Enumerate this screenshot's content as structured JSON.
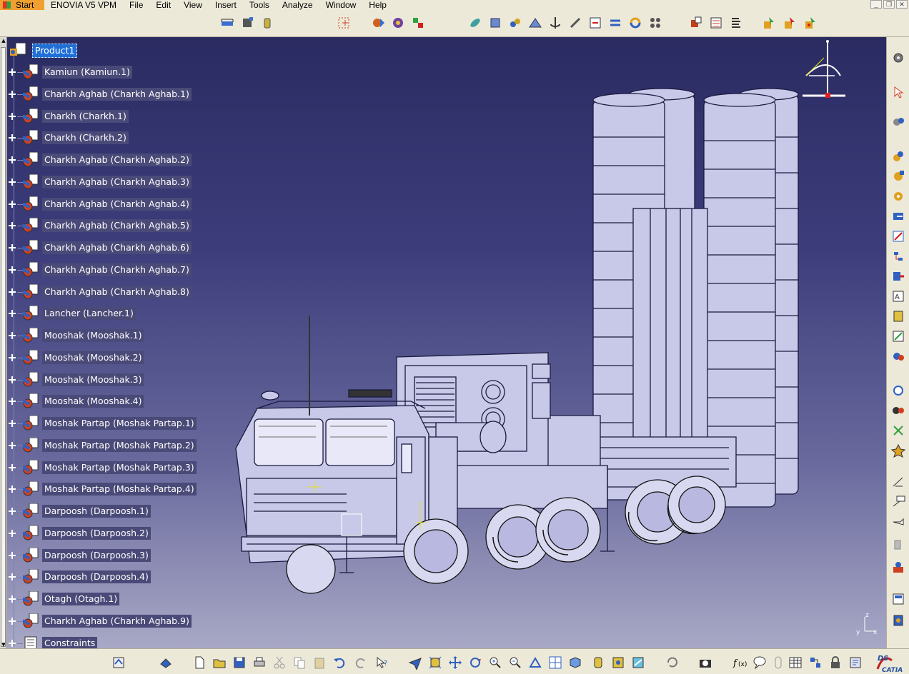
{
  "menubar": {
    "start": "Start",
    "items": [
      "ENOVIA V5 VPM",
      "File",
      "Edit",
      "View",
      "Insert",
      "Tools",
      "Analyze",
      "Window",
      "Help"
    ]
  },
  "tree": {
    "root": "Product1",
    "nodes": [
      "Kamiun (Kamiun.1)",
      "Charkh Aghab (Charkh Aghab.1)",
      "Charkh (Charkh.1)",
      "Charkh (Charkh.2)",
      "Charkh Aghab (Charkh Aghab.2)",
      "Charkh Aghab (Charkh Aghab.3)",
      "Charkh Aghab (Charkh Aghab.4)",
      "Charkh Aghab (Charkh Aghab.5)",
      "Charkh Aghab (Charkh Aghab.6)",
      "Charkh Aghab (Charkh Aghab.7)",
      "Charkh Aghab (Charkh Aghab.8)",
      "Lancher (Lancher.1)",
      "Mooshak (Mooshak.1)",
      "Mooshak (Mooshak.2)",
      "Mooshak (Mooshak.3)",
      "Mooshak (Mooshak.4)",
      "Moshak Partap (Moshak Partap.1)",
      "Moshak Partap (Moshak Partap.2)",
      "Moshak Partap (Moshak Partap.3)",
      "Moshak Partap (Moshak Partap.4)",
      "Darpoosh (Darpoosh.1)",
      "Darpoosh (Darpoosh.2)",
      "Darpoosh (Darpoosh.3)",
      "Darpoosh (Darpoosh.4)",
      "Otagh (Otagh.1)",
      "Charkh Aghab (Charkh Aghab.9)",
      "Constraints"
    ]
  },
  "axis": {
    "x": "x",
    "y": "y",
    "z": "z"
  },
  "logo": {
    "ds": "DS",
    "name": "CATIA"
  },
  "colors": {
    "viewport_top": "#2b2b62",
    "viewport_bottom": "#a8a8c6",
    "tree_label_bg": "#4a4a78",
    "root_selected_bg": "#2070d8",
    "model": "#c8c8e8"
  }
}
